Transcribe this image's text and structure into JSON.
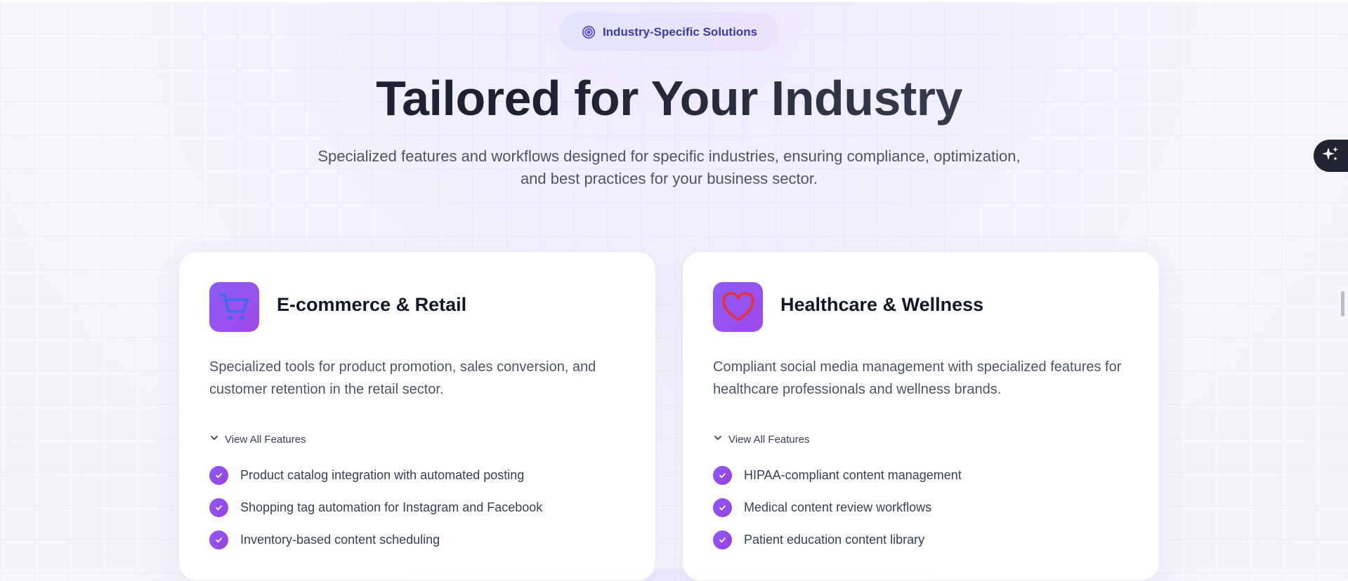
{
  "badge": {
    "label": "Industry-Specific Solutions",
    "icon": "target-icon"
  },
  "heading": "Tailored for Your Industry",
  "subheading": "Specialized features and workflows designed for specific industries, ensuring compliance, optimization, and best practices for your business sector.",
  "colors": {
    "accent": "#8b5cf6",
    "heading": "#1c2133",
    "text": "#4b5563"
  },
  "cards": [
    {
      "icon": "shopping-cart-icon",
      "title": "E-commerce & Retail",
      "description": "Specialized tools for product promotion, sales conversion, and customer retention in the retail sector.",
      "toggle_label": "View All Features",
      "features": [
        "Product catalog integration with automated posting",
        "Shopping tag automation for Instagram and Facebook",
        "Inventory-based content scheduling"
      ]
    },
    {
      "icon": "heart-icon",
      "title": "Healthcare & Wellness",
      "description": "Compliant social media management with specialized features for healthcare professionals and wellness brands.",
      "toggle_label": "View All Features",
      "features": [
        "HIPAA-compliant content management",
        "Medical content review workflows",
        "Patient education content library"
      ]
    }
  ],
  "floating_action": {
    "icon": "sparkles-icon"
  }
}
